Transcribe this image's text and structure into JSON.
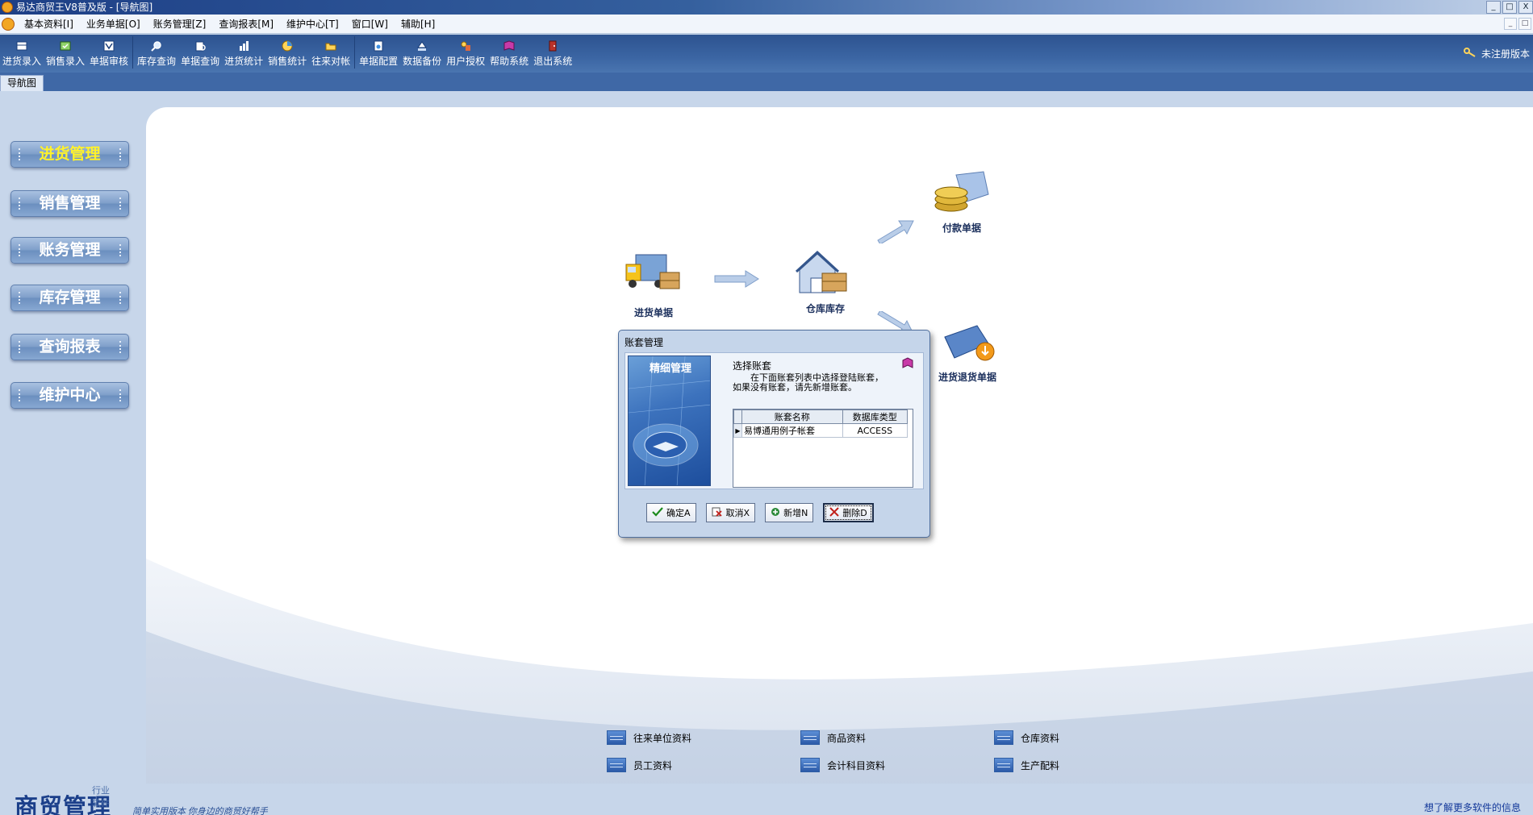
{
  "window": {
    "title": "易达商贸王V8普及版 - [导航图]",
    "controls": [
      "_",
      "□",
      "X"
    ]
  },
  "menubar": {
    "items": [
      "基本资料[I]",
      "业务单据[O]",
      "账务管理[Z]",
      "查询报表[M]",
      "维护中心[T]",
      "窗口[W]",
      "辅助[H]"
    ]
  },
  "toolbar": {
    "buttons": [
      "进货录入",
      "销售录入",
      "单据审核",
      "库存查询",
      "单据查询",
      "进货统计",
      "销售统计",
      "往来对帐",
      "单据配置",
      "数据备份",
      "用户授权",
      "帮助系统",
      "退出系统"
    ],
    "unregistered": "未注册版本"
  },
  "tab": {
    "label": "导航图"
  },
  "sidebar": {
    "items": [
      "进货管理",
      "销售管理",
      "账务管理",
      "库存管理",
      "查询报表",
      "维护中心"
    ],
    "active": 0
  },
  "flow": {
    "purchase": "进货单据",
    "warehouse": "仓库库存",
    "payment": "付款单据",
    "return": "进货退货单据"
  },
  "links": [
    "往来单位资料",
    "商品资料",
    "仓库资料",
    "员工资料",
    "会计科目资料",
    "生产配料"
  ],
  "branding": {
    "logo": "商贸管理",
    "logo_small": "行业软件",
    "slogan": "简单实用版本 你身边的商贸好帮手"
  },
  "footer": {
    "more": "想了解更多软件的信息"
  },
  "dialog": {
    "title": "账套管理",
    "image_caption": "精细管理",
    "heading": "选择账套",
    "desc_line1": "　　在下面账套列表中选择登陆账套，",
    "desc_line2": "如果没有账套，请先新增账套。",
    "col_name": "账套名称",
    "col_type": "数据库类型",
    "rows": [
      {
        "name": "易博通用例子帐套",
        "type": "ACCESS"
      }
    ],
    "buttons": {
      "ok": "确定A",
      "cancel": "取消X",
      "new": "新增N",
      "delete": "删除D"
    }
  },
  "colors": {
    "toolbar_bg": "#3b65a3",
    "nav_active_text": "#fff22a",
    "main_bg": "#ffffff",
    "link_blue": "#13389a"
  }
}
